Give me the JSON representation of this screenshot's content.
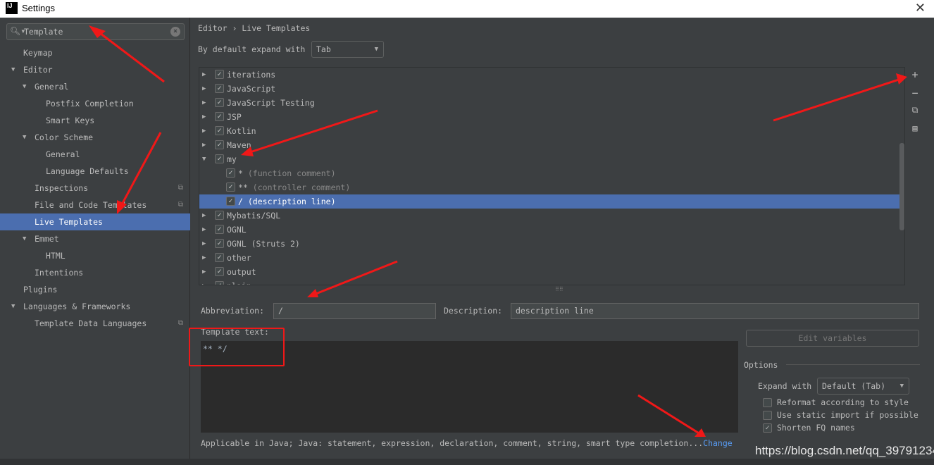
{
  "window": {
    "title": "Settings",
    "logo": "IJ",
    "close_icon": "close-icon"
  },
  "search": {
    "value": "Template",
    "icon": "search-icon",
    "clear_icon": "clear-icon"
  },
  "sidebar": {
    "items": [
      {
        "label": "Keymap",
        "level": 0
      },
      {
        "label": "Editor",
        "level": 0,
        "expanded": true
      },
      {
        "label": "General",
        "level": 1,
        "expanded": true
      },
      {
        "label": "Postfix Completion",
        "level": 2
      },
      {
        "label": "Smart Keys",
        "level": 2
      },
      {
        "label": "Color Scheme",
        "level": 1,
        "expanded": true
      },
      {
        "label": "General",
        "level": 2
      },
      {
        "label": "Language Defaults",
        "level": 2
      },
      {
        "label": "Inspections",
        "level": 1,
        "copy": true
      },
      {
        "label": "File and Code Templates",
        "level": 1,
        "copy": true
      },
      {
        "label": "Live Templates",
        "level": 1,
        "selected": true
      },
      {
        "label": "Emmet",
        "level": 1,
        "expanded": true
      },
      {
        "label": "HTML",
        "level": 2
      },
      {
        "label": "Intentions",
        "level": 1
      },
      {
        "label": "Plugins",
        "level": 0
      },
      {
        "label": "Languages & Frameworks",
        "level": 0,
        "expanded": true
      },
      {
        "label": "Template Data Languages",
        "level": 1,
        "copy": true
      }
    ]
  },
  "main": {
    "breadcrumb": [
      "Editor",
      "Live Templates"
    ],
    "breadcrumb_sep": "›",
    "expand_label": "By default expand with",
    "expand_value": "Tab",
    "tree": [
      {
        "label": "iterations",
        "checked": true,
        "group": true
      },
      {
        "label": "JavaScript",
        "checked": true,
        "group": true
      },
      {
        "label": "JavaScript Testing",
        "checked": true,
        "group": true
      },
      {
        "label": "JSP",
        "checked": true,
        "group": true
      },
      {
        "label": "Kotlin",
        "checked": true,
        "group": true
      },
      {
        "label": "Maven",
        "checked": true,
        "group": true
      },
      {
        "label": "my",
        "checked": true,
        "group": true,
        "expanded": true
      },
      {
        "label": "*",
        "desc": "(function comment)",
        "checked": true
      },
      {
        "label": "**",
        "desc": "(controller comment)",
        "checked": true
      },
      {
        "label": "/",
        "desc": "(description line)",
        "checked": true,
        "selected": true
      },
      {
        "label": "Mybatis/SQL",
        "checked": true,
        "group": true
      },
      {
        "label": "OGNL",
        "checked": true,
        "group": true
      },
      {
        "label": "OGNL (Struts 2)",
        "checked": true,
        "group": true
      },
      {
        "label": "other",
        "checked": true,
        "group": true
      },
      {
        "label": "output",
        "checked": true,
        "group": true
      },
      {
        "label": "plain",
        "checked": true,
        "group": true
      }
    ],
    "toolbar": {
      "add": "+",
      "remove": "−"
    },
    "abbreviation_label": "Abbreviation:",
    "abbreviation_value": "/",
    "description_label": "Description:",
    "description_value": "description line",
    "template_text_label": "Template text:",
    "template_text": "** */",
    "edit_variables": "Edit variables",
    "options_title": "Options",
    "expand_with_label": "Expand with",
    "expand_with_value": "Default (Tab)",
    "options": [
      {
        "label": "Reformat according to style",
        "checked": false
      },
      {
        "label": "Use static import if possible",
        "checked": false
      },
      {
        "label": "Shorten FQ names",
        "checked": true
      }
    ],
    "applicable": "Applicable in Java; Java: statement, expression, declaration, comment, string, smart type completion...",
    "change_link": "Change"
  },
  "watermark": "https://blog.csdn.net/qq_39791234",
  "colors": {
    "background": "#3c3f41",
    "selection": "#4b6eaf",
    "editor": "#2b2b2b",
    "link": "#589df6",
    "annotation": "#f01818"
  }
}
